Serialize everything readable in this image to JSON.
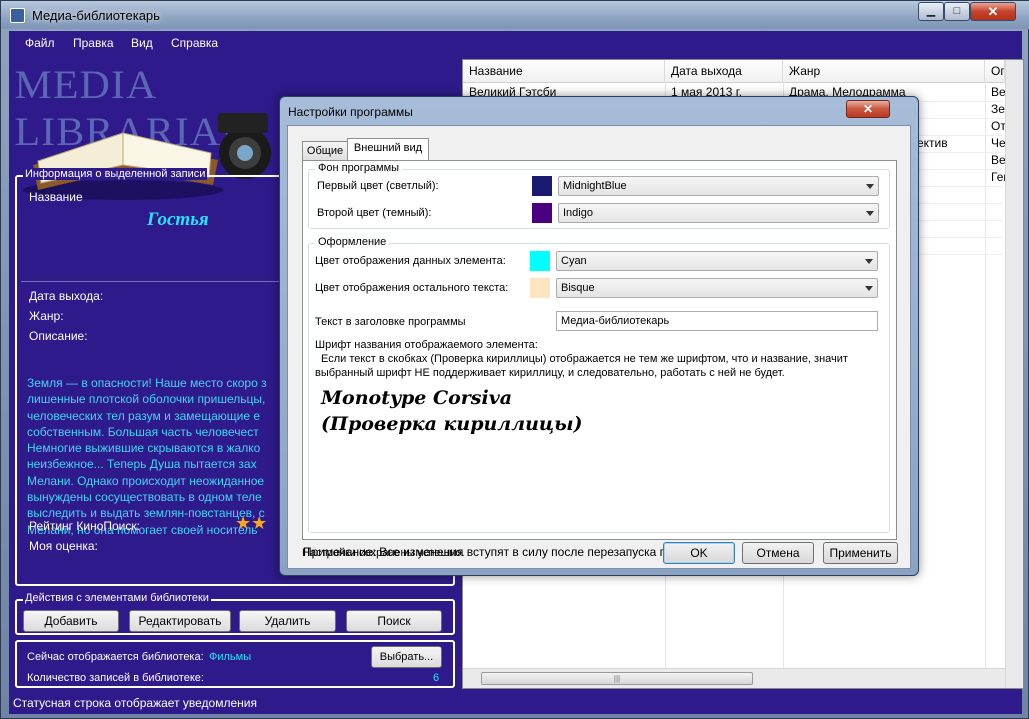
{
  "window": {
    "title": "Медиа-библиотекарь",
    "minimize": "▁",
    "maximize": "□",
    "close": "✕"
  },
  "menu": [
    "Файл",
    "Правка",
    "Вид",
    "Справка"
  ],
  "logo_text": "MEDIA LIBRARIAN",
  "info": {
    "legend": "Информация о выделенной записи",
    "name_label": "Название",
    "name_value": "Гостья",
    "release_label": "Дата выхода:",
    "genre_label": "Жанр:",
    "description_label": "Описание:",
    "description_lines": [
      "Земля — в опасности! Наше место скоро з",
      "лишенные плотской оболочки пришельцы,",
      "человеческих тел разум и замещающие е",
      "собственным. Большая часть человечест",
      "Немногие выжившие скрываются в жалко",
      "неизбежное... Теперь Душа пытается зах",
      "Мелани. Однако происходит неожиданное",
      "вынуждены сосуществовать в одном теле",
      "выследить и выдать землян-повстанцев, с",
      "Мелани, но она помогает своей носитель"
    ],
    "rating_label": "Рейтинг КиноПоиск:",
    "rating_stars": "★★",
    "my_rating_label": "Моя оценка:"
  },
  "actions": {
    "legend": "Действия с элементами библиотеки",
    "add": "Добавить",
    "edit": "Редактировать",
    "delete": "Удалить",
    "search": "Поиск"
  },
  "library": {
    "current_label": "Сейчас отображается библиотека:",
    "current_value": "Фильмы",
    "choose_button": "Выбрать...",
    "count_label": "Количество записей в библиотеке:",
    "count_value": "6"
  },
  "statusbar": "Статусная строка отображает уведомления",
  "grid": {
    "columns": [
      "Название",
      "Дата выхода",
      "Жанр",
      "Оп"
    ],
    "rows": [
      [
        "Великий Гэтсби",
        "1 мая 2013 г.",
        "Драма, Мелодрамма",
        "Вес"
      ],
      [
        "",
        "",
        "",
        "Зем"
      ],
      [
        "",
        "",
        "",
        "От"
      ],
      [
        "",
        "",
        "ектив",
        "Че"
      ],
      [
        "",
        "",
        "",
        "Вес"
      ],
      [
        "",
        "",
        "",
        "Ген"
      ]
    ],
    "hscroll_grip": "|||"
  },
  "dialog": {
    "title": "Настройки программы",
    "close": "✕",
    "tabs": [
      "Общие",
      "Внешний вид"
    ],
    "bg_legend": "Фон программы",
    "first_color_label": "Первый цвет (светлый):",
    "first_color_value": "MidnightBlue",
    "first_color_hex": "#191970",
    "second_color_label": "Второй цвет (темный):",
    "second_color_value": "Indigo",
    "second_color_hex": "#4b0082",
    "design_legend": "Оформление",
    "data_color_label": "Цвет отображения данных элемента:",
    "data_color_value": "Cyan",
    "data_color_hex": "#00ffff",
    "text_color_label": "Цвет отображения остального текста:",
    "text_color_value": "Bisque",
    "text_color_hex": "#ffe4c4",
    "header_text_label": "Текст в заголовке программы",
    "header_text_value": "Медиа-библиотекарь",
    "font_label": "Шрифт названия отображаемого элемента:",
    "font_note_1": "Если текст в скобках (Проверка кириллицы) отображается не тем же шрифтом, что и название, значит",
    "font_note_2": "выбранный шрифт НЕ поддерживает кириллицу, и следовательно, работать с ней не будет.",
    "font_sample_1": "Monotype Corsiva",
    "font_sample_2": "(Проверка кириллицы)",
    "note": "Примечание: Все изменения вступят в силу после перезапуска программы!",
    "saved_status": "Настройки сохранены успешно.",
    "ok": "OK",
    "cancel": "Отмена",
    "apply": "Применить"
  },
  "colors": {
    "panel_bg": "#2e1a8a",
    "accent_cyan": "#25e4f7",
    "description": "#44d4f4",
    "star": "#f5a91b"
  }
}
